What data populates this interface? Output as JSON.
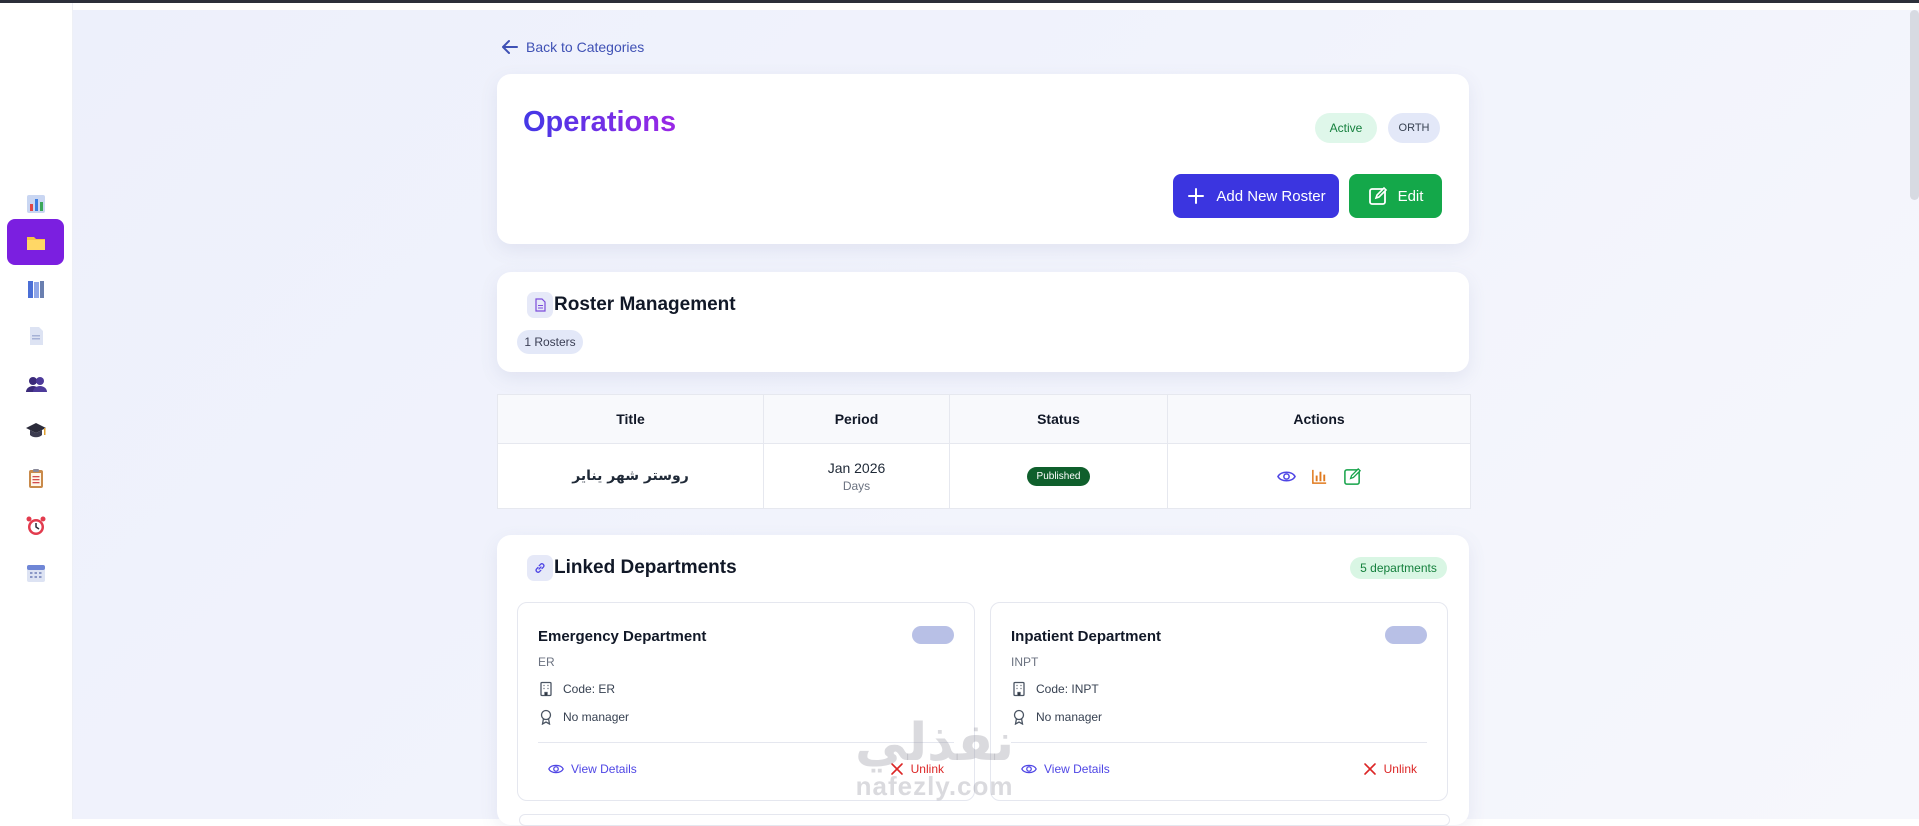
{
  "nav": {
    "back_label": "Back to Categories",
    "items": [
      {
        "icon": "bar-chart-icon"
      },
      {
        "icon": "folder-icon",
        "active": true
      },
      {
        "icon": "books-icon"
      },
      {
        "icon": "document-icon"
      },
      {
        "icon": "users-icon"
      },
      {
        "icon": "graduation-cap-icon"
      },
      {
        "icon": "clipboard-icon"
      },
      {
        "icon": "alarm-clock-icon"
      },
      {
        "icon": "calendar-icon"
      }
    ]
  },
  "header": {
    "title": "Operations",
    "status_badge": "Active",
    "code_badge": "ORTH",
    "add_roster_label": "Add New Roster",
    "edit_label": "Edit"
  },
  "roster": {
    "section_title": "Roster Management",
    "count_label": "1 Rosters",
    "columns": [
      "Title",
      "Period",
      "Status",
      "Actions"
    ],
    "rows": [
      {
        "title": "روستر شهر يناير",
        "period": "Jan 2026",
        "period_unit": "Days",
        "status": "Published"
      }
    ]
  },
  "departments": {
    "section_title": "Linked Departments",
    "count_label": "5 departments",
    "view_label": "View Details",
    "unlink_label": "Unlink",
    "items": [
      {
        "name": "Emergency Department",
        "short": "ER",
        "code": "Code: ER",
        "manager": "No manager"
      },
      {
        "name": "Inpatient Department",
        "short": "INPT",
        "code": "Code: INPT",
        "manager": "No manager"
      }
    ]
  },
  "watermark": {
    "arabic": "نفذلي",
    "latin": "nafezly.com"
  },
  "colors": {
    "accent": "#3b35e0",
    "active_nav": "#7b1fe0",
    "success": "#14a84a",
    "published": "#0f5f2c",
    "danger": "#dc2626"
  }
}
